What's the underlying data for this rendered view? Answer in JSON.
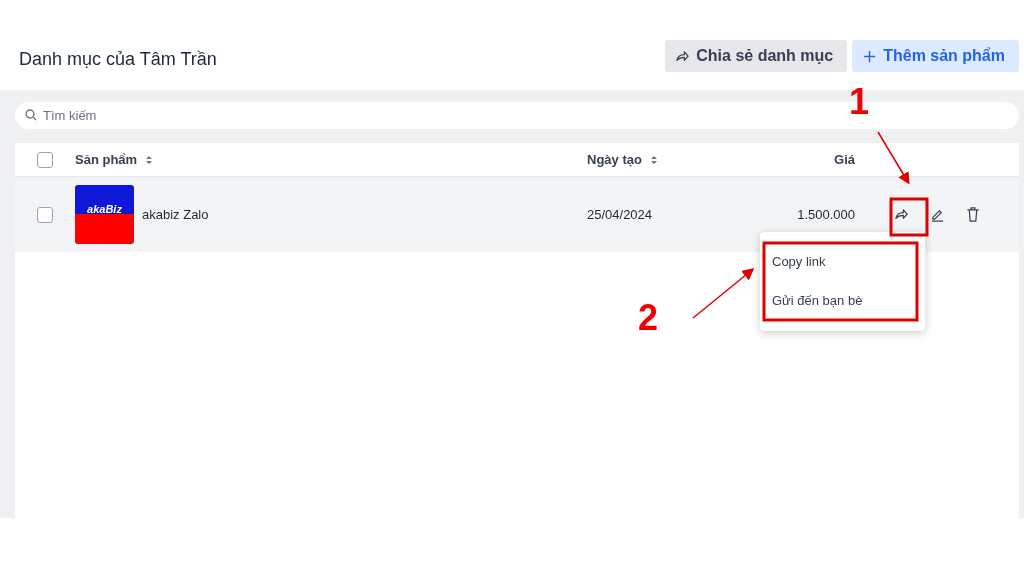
{
  "header": {
    "title": "Danh mục của Tâm Trần",
    "buttons": [
      {
        "kind": "secondary",
        "label": "Chia sẻ danh mục"
      },
      {
        "kind": "primary",
        "label": "Thêm sản phẩm"
      }
    ]
  },
  "search": {
    "placeholder": "Tìm kiếm"
  },
  "table": {
    "header_checked": false,
    "columns": [
      {
        "label": "Sản phẩm",
        "sortable": true
      },
      {
        "label": "Ngày tạo",
        "sortable": true
      },
      {
        "label": "Giá",
        "sortable": false
      }
    ],
    "rows": [
      {
        "checked": false,
        "thumbnail_text": "akaBiz",
        "name": "akabiz Zalo",
        "date": "25/04/2024",
        "price": "1.500.000"
      }
    ]
  },
  "share_menu": {
    "items": [
      "Copy link",
      "Gửi đến bạn bè"
    ]
  },
  "annotations": [
    {
      "label": "1"
    },
    {
      "label": "2"
    }
  ]
}
